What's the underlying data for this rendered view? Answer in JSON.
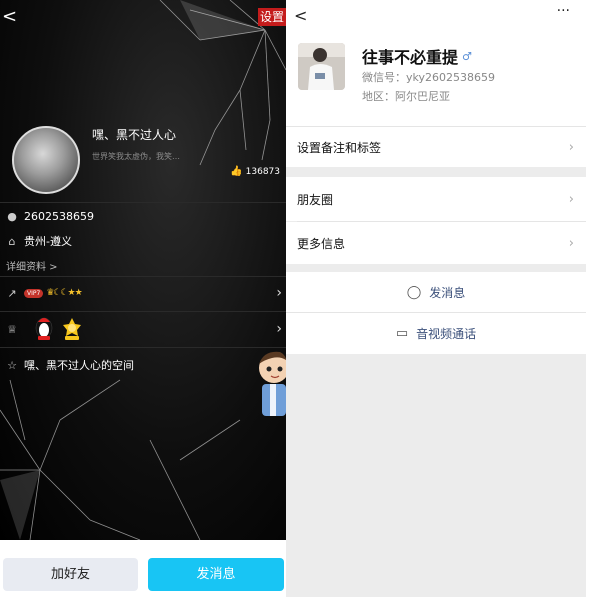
{
  "qq_profile": {
    "settings_label": "设置",
    "nickname": "嘿、黑不过人心",
    "signature": "世界笑我太虚伪，我笑…",
    "likes": "136873",
    "qq_number": "2602538659",
    "location": "贵州-遵义",
    "details_link": "详细资料 >",
    "vip_label": "VIP7",
    "level_icons": "♛☾☾★★",
    "space_label": "嘿、黑不过人心的空间",
    "add_friend_button": "加好友",
    "send_message_button": "发消息"
  },
  "wechat_profile": {
    "name": "往事不必重提",
    "wechat_id": "微信号：yky2602538659",
    "region": "地区：阿尔巴尼亚",
    "menu": {
      "remark_tags": "设置备注和标签",
      "moments": "朋友圈",
      "more_info": "更多信息"
    },
    "actions": {
      "send_message": "发消息",
      "video_call": "音视频通话"
    }
  },
  "colors": {
    "qq_send_button": "#18c5f4",
    "qq_add_button": "#e8ebf2",
    "wechat_action_text": "#3a4f7a",
    "vip_badge": "#c3332a"
  }
}
